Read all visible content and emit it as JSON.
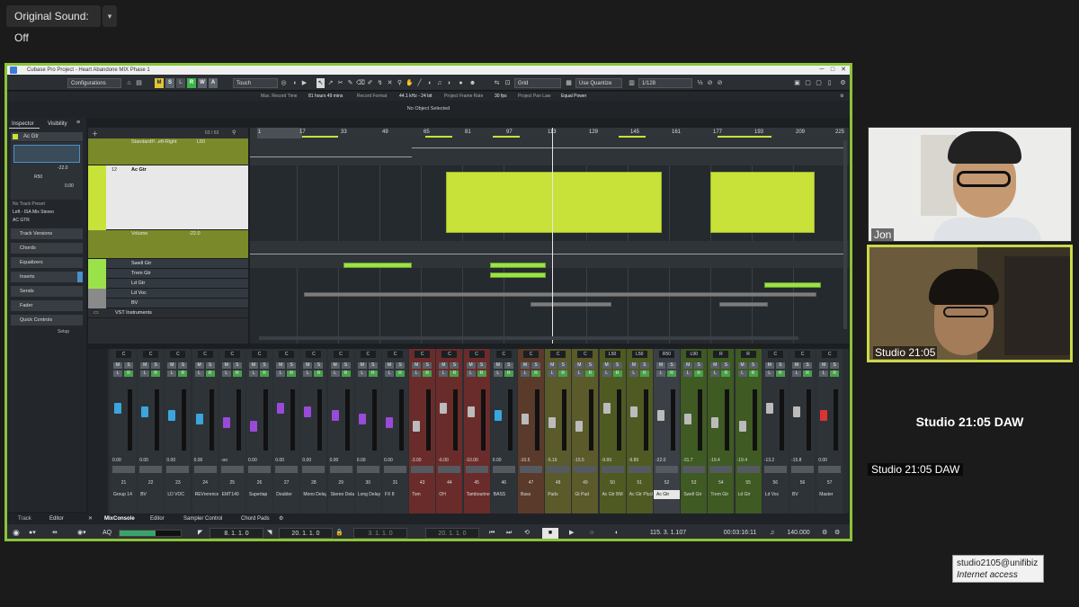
{
  "zoom": {
    "original_sound_label": "Original Sound: Off",
    "dropdown_glyph": "▾"
  },
  "cubase": {
    "window_title": "Cubase Pro Project - Heart Abandone MIX Phase 1",
    "toolbar": {
      "configurations": "Configurations",
      "mode_buttons": [
        "M",
        "S",
        "L",
        "R",
        "W",
        "A"
      ],
      "automation_mode": "Touch",
      "snap": "Grid",
      "quantize_mode": "Use Quantize",
      "quantize_value": "1/128"
    },
    "info_line": {
      "max_record_time_label": "Max. Record Time",
      "max_record_time": "81 hours 49 mins",
      "record_format_label": "Record Format",
      "record_format": "44.1 kHz - 24 bit",
      "frame_rate_label": "Project Frame Rate",
      "frame_rate": "30 fps",
      "pan_law_label": "Project Pan Law",
      "pan_law": "Equal Power"
    },
    "no_object": "No Object Selected",
    "inspector": {
      "tab_inspector": "Inspector",
      "tab_visibility": "Visibility",
      "track_name": "Ac Gtr",
      "volume_value": "-22.0",
      "pan_value": "R50",
      "delay_value": "0.00",
      "no_track_preset": "No Track Preset",
      "input_routing": "Left - ISA Mix Stereo",
      "output_routing": "AC GTR",
      "sections": [
        "Track Versions",
        "Chords",
        "Equalizers",
        "Inserts",
        "Sends",
        "Fader",
        "Quick Controls"
      ],
      "setup": "Setup"
    },
    "track_counter": "63 / 63",
    "tracks": [
      {
        "name": "StandardP...eft-Right",
        "value": "L50"
      },
      {
        "name": "Ac Gtr",
        "number": "12"
      },
      {
        "name": "Volume",
        "value": "-22.0"
      },
      {
        "name": "Swell Gtr"
      },
      {
        "name": "Trem Gtr"
      },
      {
        "name": "Ld Gtr"
      },
      {
        "name": "Ld Voc"
      },
      {
        "name": "BV"
      },
      {
        "name": "VST Instruments"
      }
    ],
    "ruler": [
      "1",
      "17",
      "33",
      "49",
      "65",
      "81",
      "97",
      "113",
      "129",
      "145",
      "161",
      "177",
      "193",
      "209",
      "225"
    ],
    "mixer_channels": [
      {
        "num": "21",
        "name": "Group 14",
        "pan": "C",
        "vol": "0.00",
        "color": "#3aa6dd"
      },
      {
        "num": "22",
        "name": "BV",
        "pan": "C",
        "vol": "0.00",
        "color": "#3aa6dd"
      },
      {
        "num": "23",
        "name": "LD VOC",
        "pan": "C",
        "vol": "0.00",
        "color": "#3aa6dd"
      },
      {
        "num": "24",
        "name": "REVrerence",
        "pan": "C",
        "vol": "0.00",
        "color": "#3aa6dd"
      },
      {
        "num": "25",
        "name": "EMT140",
        "pan": "C",
        "vol": "-oo",
        "color": "#9a4ad8"
      },
      {
        "num": "26",
        "name": "Supertap",
        "pan": "C",
        "vol": "0.00",
        "color": "#9a4ad8"
      },
      {
        "num": "27",
        "name": "Doubler",
        "pan": "C",
        "vol": "0.00",
        "color": "#9a4ad8"
      },
      {
        "num": "28",
        "name": "Mono Delay",
        "pan": "C",
        "vol": "0.00",
        "color": "#9a4ad8"
      },
      {
        "num": "29",
        "name": "Stereo Delay",
        "pan": "C",
        "vol": "0.00",
        "color": "#9a4ad8"
      },
      {
        "num": "30",
        "name": "Long Delay",
        "pan": "C",
        "vol": "0.00",
        "color": "#9a4ad8"
      },
      {
        "num": "31",
        "name": "FX 8",
        "pan": "C",
        "vol": "0.00",
        "color": "#9a4ad8"
      },
      {
        "num": "43",
        "name": "Tom",
        "pan": "C",
        "vol": "-3.00",
        "color": "#bbbbbb"
      },
      {
        "num": "44",
        "name": "OH",
        "pan": "C",
        "vol": "-6.00",
        "color": "#bbbbbb"
      },
      {
        "num": "45",
        "name": "Tambourine",
        "pan": "C",
        "vol": "-10.00",
        "color": "#bbbbbb"
      },
      {
        "num": "46",
        "name": "BASS",
        "pan": "C",
        "vol": "0.00",
        "color": "#3aa6dd"
      },
      {
        "num": "47",
        "name": "Bass",
        "pan": "C",
        "vol": "-10.5",
        "color": "#bbbbbb"
      },
      {
        "num": "48",
        "name": "Pads",
        "pan": "C",
        "vol": "-5.19",
        "color": "#bbbbbb"
      },
      {
        "num": "49",
        "name": "Gt Pad",
        "pan": "C",
        "vol": "-15.5",
        "color": "#bbbbbb"
      },
      {
        "num": "50",
        "name": "Ac Gtr BM",
        "pan": "L50",
        "vol": "-9.89",
        "color": "#bbbbbb"
      },
      {
        "num": "51",
        "name": "Ac Gtr Pluck",
        "pan": "L50",
        "vol": "-9.89",
        "color": "#bbbbbb"
      },
      {
        "num": "52",
        "name": "Ac Gtr",
        "pan": "R50",
        "vol": "-22.0",
        "color": "#bbbbbb"
      },
      {
        "num": "53",
        "name": "Swell Gtr",
        "pan": "L90",
        "vol": "-31.7",
        "color": "#bbbbbb"
      },
      {
        "num": "54",
        "name": "Trem Gtr",
        "pan": "R",
        "vol": "-19.4",
        "color": "#bbbbbb"
      },
      {
        "num": "55",
        "name": "Ld Gtr",
        "pan": "R",
        "vol": "-19.4",
        "color": "#bbbbbb"
      },
      {
        "num": "56",
        "name": "Ld Voc",
        "pan": "C",
        "vol": "-13.2",
        "color": "#bbbbbb"
      },
      {
        "num": "56",
        "name": "BV",
        "pan": "C",
        "vol": "-15.8",
        "color": "#bbbbbb"
      },
      {
        "num": "57",
        "name": "Master",
        "pan": "C",
        "vol": "0.00",
        "color": "#dd3333"
      }
    ],
    "lower_zone_tabs": [
      "Track",
      "Editor",
      "MixConsole",
      "Editor",
      "Sampler Control",
      "Chord Pads"
    ],
    "transport": {
      "left_locator": "8. 1. 1. 0",
      "right_locator": "20. 1. 1. 0",
      "punch_in": "3. 1. 1. 0",
      "punch_out": "20. 1. 1. 0",
      "position_bars": "115. 3. 1.107",
      "position_time": "00:03:16:11",
      "tempo": "140.000"
    }
  },
  "participants": [
    {
      "label": "Jon"
    },
    {
      "label": "Studio 21:05"
    },
    {
      "label": "Studio 21:05 DAW",
      "caption": "Studio 21:05 DAW"
    }
  ],
  "tooltip": {
    "email": "studio2105@unifibiz",
    "status": "Internet access"
  },
  "colors": {
    "active_speaker": "#c8d94a",
    "share_border": "#89c43a",
    "clip_green": "#c8e23a",
    "midi_green": "#9be24a"
  }
}
